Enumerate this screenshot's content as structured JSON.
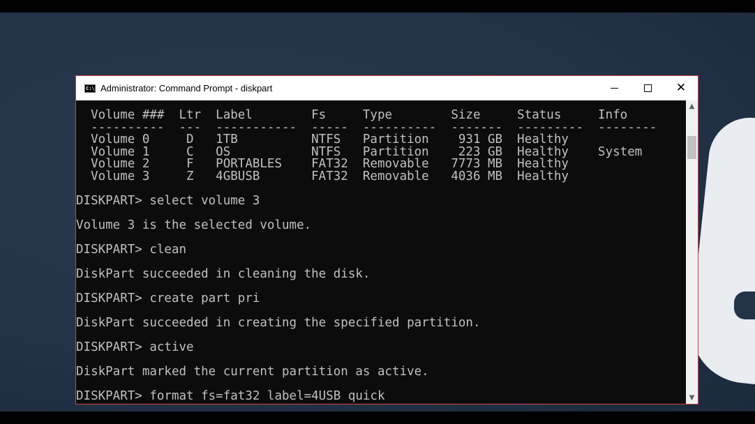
{
  "window": {
    "title": "Administrator: Command Prompt - diskpart",
    "icon": "cmd-icon",
    "controls": {
      "minimize": "minimize-icon",
      "maximize": "maximize-icon",
      "close": "close-icon"
    }
  },
  "console": {
    "lines": [
      "  Volume ###  Ltr  Label        Fs     Type        Size     Status     Info",
      "  ----------  ---  -----------  -----  ----------  -------  ---------  --------",
      "  Volume 0     D   1TB          NTFS   Partition    931 GB  Healthy",
      "  Volume 1     C   OS           NTFS   Partition    223 GB  Healthy    System",
      "  Volume 2     F   PORTABLES    FAT32  Removable   7773 MB  Healthy",
      "  Volume 3     Z   4GBUSB       FAT32  Removable   4036 MB  Healthy",
      "",
      "DISKPART> select volume 3",
      "",
      "Volume 3 is the selected volume.",
      "",
      "DISKPART> clean",
      "",
      "DiskPart succeeded in cleaning the disk.",
      "",
      "DISKPART> create part pri",
      "",
      "DiskPart succeeded in creating the specified partition.",
      "",
      "DISKPART> active",
      "",
      "DiskPart marked the current partition as active.",
      "",
      "DISKPART> format fs=fat32 label=4USB quick"
    ]
  },
  "colors": {
    "console_bg": "#0c0c0c",
    "console_text": "#c0c0c0",
    "window_border": "#c7474b"
  }
}
